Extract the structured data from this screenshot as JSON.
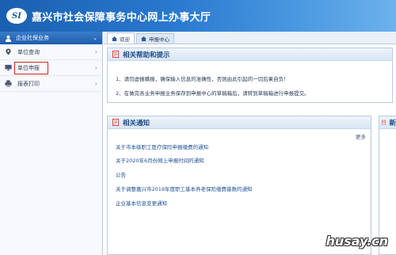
{
  "header": {
    "logo_text": "SI",
    "title": "嘉兴市社会保障事务中心网上办事大厅"
  },
  "sidebar": {
    "section_title": "企业社保业务",
    "items": [
      {
        "label": "单位查询",
        "icon": "location-pin-icon"
      },
      {
        "label": "单位申报",
        "icon": "monitor-icon",
        "highlighted": true
      },
      {
        "label": "报表打印",
        "icon": "printer-icon"
      }
    ]
  },
  "tabs": [
    {
      "label": "欢迎",
      "active": true
    },
    {
      "label": "申报中心",
      "active": false
    }
  ],
  "help_panel": {
    "title": "相关帮助和提示",
    "lines": [
      "1、请勿虚报瞒报，确保输入信息的准确性，否则由此引起的一切后果自负！",
      "2、在做完各业务申报业务保存到申报中心的草稿箱后，请转到草稿箱进行申报提交。"
    ]
  },
  "notice_panel": {
    "title": "相关通知",
    "more_label": "更多",
    "items": [
      "关于市本级职工医疗保险申报缴费的通知",
      "关于2020年6月份网上申报时间的通知",
      "公告",
      "关于调整嘉兴市2019年度职工基本养老保险缴费基数的通知",
      "企业基本信息变更通知"
    ]
  },
  "right_panel": {
    "title": "新"
  },
  "watermark": "husay.cn",
  "colors": {
    "header_blue": "#1a5fb0",
    "link_blue": "#1e4f95",
    "highlight_red": "#e02020"
  }
}
